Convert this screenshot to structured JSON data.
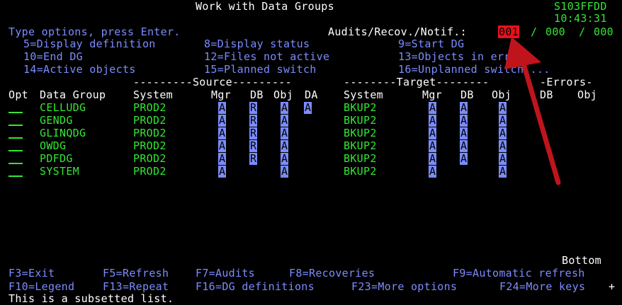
{
  "header": {
    "title": "Work with Data Groups",
    "system_name": "S103FFDD",
    "time": "10:43:31"
  },
  "instructions": "Type options, press Enter.",
  "audit_status": {
    "label": "Audits/Recov./Notif.:",
    "audits": "001",
    "recoveries": "000",
    "notifications": "000"
  },
  "options": [
    "5=Display definition",
    "8=Display status",
    "9=Start DG",
    "10=End DG",
    "12=Files not active",
    "13=Objects in error",
    "14=Active objects",
    "15=Planned switch",
    "16=Unplanned switch ..."
  ],
  "group_headers": {
    "source": "---------Source---------",
    "target": "--------Target--------",
    "errors": "-Errors-"
  },
  "columns": {
    "opt": "Opt",
    "data_group": "Data Group",
    "system": "System",
    "mgr": "Mgr",
    "db": "DB",
    "obj": "Obj",
    "da": "DA",
    "tsystem": "System",
    "tmgr": "Mgr",
    "tdb": "DB",
    "tobj": "Obj",
    "edb": "DB",
    "eobj": "Obj"
  },
  "rows": [
    {
      "name": "CELLUDG",
      "system": "PROD2",
      "mgr": "A",
      "db": "R",
      "obj": "A",
      "da": "A",
      "tsystem": "BKUP2",
      "tmgr": "A",
      "tdb": "A",
      "tobj": "A"
    },
    {
      "name": "GENDG",
      "system": "PROD2",
      "mgr": "A",
      "db": "R",
      "obj": "A",
      "da": "",
      "tsystem": "BKUP2",
      "tmgr": "A",
      "tdb": "A",
      "tobj": "A"
    },
    {
      "name": "GLINQDG",
      "system": "PROD2",
      "mgr": "A",
      "db": "R",
      "obj": "A",
      "da": "",
      "tsystem": "BKUP2",
      "tmgr": "A",
      "tdb": "A",
      "tobj": "A"
    },
    {
      "name": "OWDG",
      "system": "PROD2",
      "mgr": "A",
      "db": "R",
      "obj": "A",
      "da": "",
      "tsystem": "BKUP2",
      "tmgr": "A",
      "tdb": "A",
      "tobj": "A"
    },
    {
      "name": "PDFDG",
      "system": "PROD2",
      "mgr": "A",
      "db": "R",
      "obj": "A",
      "da": "",
      "tsystem": "BKUP2",
      "tmgr": "A",
      "tdb": "A",
      "tobj": "A"
    },
    {
      "name": "SYSTEM",
      "system": "PROD2",
      "mgr": "A",
      "db": "",
      "obj": "A",
      "da": "",
      "tsystem": "BKUP2",
      "tmgr": "A",
      "tdb": "",
      "tobj": "A"
    }
  ],
  "bottom_indicator": "Bottom",
  "function_keys": {
    "f3": "F3=Exit",
    "f5": "F5=Refresh",
    "f7": "F7=Audits",
    "f8": "F8=Recoveries",
    "f9": "F9=Automatic refresh",
    "f10": "F10=Legend",
    "f13": "F13=Repeat",
    "f16": "F16=DG definitions",
    "f23": "F23=More options",
    "f24": "F24=More keys"
  },
  "more_indicator": "+",
  "message": "This is a subsetted list.",
  "colors": {
    "background": "#000000",
    "field_blue": "#7b8cff",
    "text_green": "#33e633",
    "highlight_red": "#e8111a",
    "arrow_red": "#c0141c"
  }
}
